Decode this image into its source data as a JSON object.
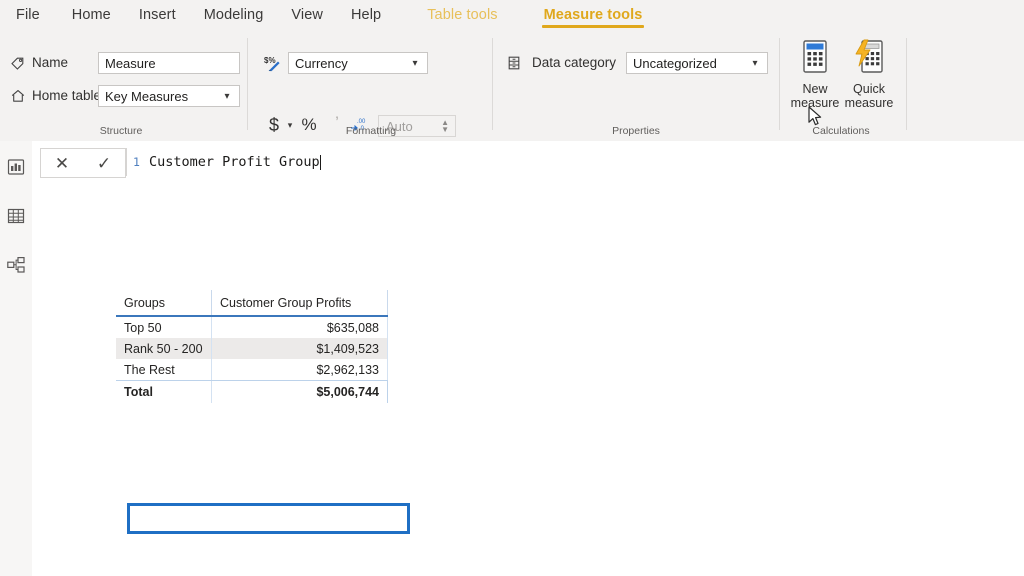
{
  "ribbon": {
    "tabs": [
      {
        "label": "File",
        "type": "file"
      },
      {
        "label": "Home",
        "type": "normal"
      },
      {
        "label": "Insert",
        "type": "normal"
      },
      {
        "label": "Modeling",
        "type": "normal"
      },
      {
        "label": "View",
        "type": "normal"
      },
      {
        "label": "Help",
        "type": "normal"
      },
      {
        "label": "Table tools",
        "type": "context"
      },
      {
        "label": "Measure tools",
        "type": "context-active"
      }
    ],
    "accent_color": "#e0a81c",
    "groups": [
      {
        "label": "Structure"
      },
      {
        "label": "Formatting"
      },
      {
        "label": "Properties"
      },
      {
        "label": "Calculations"
      }
    ],
    "structure": {
      "name_label": "Name",
      "name_icon": "tag-icon",
      "name_value": "Measure",
      "home_table_label": "Home table",
      "home_table_icon": "home-icon",
      "home_table_value": "Key Measures"
    },
    "formatting": {
      "format_icon": "format-percent-icon",
      "format_value": "Currency",
      "currency_button": "$",
      "percent_button": "%",
      "comma_button": "comma-style-icon",
      "decimal_button": "decrease-decimals-icon",
      "decimals_value": "",
      "decimals_placeholder": "Auto"
    },
    "properties": {
      "data_category_icon": "data-category-icon",
      "data_category_label": "Data category",
      "data_category_value": "Uncategorized"
    },
    "calculations": {
      "new_measure_line1": "New",
      "new_measure_line2": "measure",
      "new_measure_icon": "calculator-icon",
      "quick_measure_line1": "Quick",
      "quick_measure_line2": "measure",
      "quick_measure_icon": "quick-calculator-icon"
    }
  },
  "rail": {
    "items": [
      {
        "icon": "report-view-icon"
      },
      {
        "icon": "data-view-icon"
      },
      {
        "icon": "model-view-icon"
      }
    ]
  },
  "formula_bar": {
    "cancel_icon": "close-icon",
    "commit_icon": "check-icon",
    "line_number": "1",
    "expression": "Customer Profit Group"
  },
  "visual": {
    "columns": [
      "Groups",
      "Customer Group Profits"
    ],
    "rows": [
      {
        "group": "Top 50",
        "profit": "$635,088",
        "banded": false,
        "highlighted": true
      },
      {
        "group": "Rank 50 - 200",
        "profit": "$1,409,523",
        "banded": true,
        "highlighted": false
      },
      {
        "group": "The Rest",
        "profit": "$2,962,133",
        "banded": false,
        "highlighted": false
      }
    ],
    "total": {
      "group": "Total",
      "profit": "$5,006,744"
    },
    "highlight_color": "#1f6fc4"
  }
}
